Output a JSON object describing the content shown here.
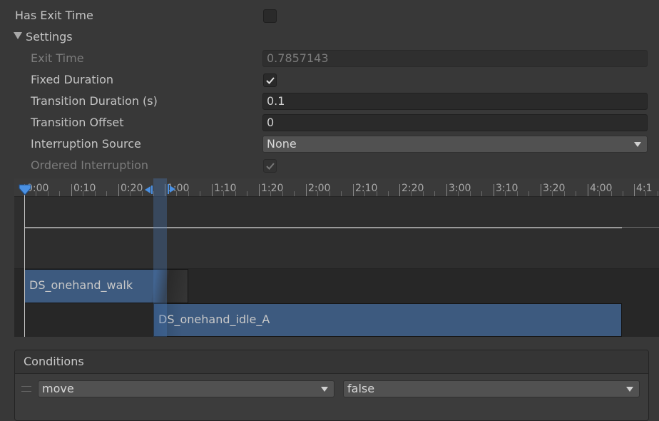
{
  "inspector": {
    "has_exit_time_label": "Has Exit Time",
    "has_exit_time_checked": false,
    "settings_label": "Settings",
    "exit_time": {
      "label": "Exit Time",
      "value": "0.7857143"
    },
    "fixed_duration": {
      "label": "Fixed Duration",
      "checked": true
    },
    "transition_duration": {
      "label": "Transition Duration (s)",
      "value": "0.1"
    },
    "transition_offset": {
      "label": "Transition Offset",
      "value": "0"
    },
    "interruption_source": {
      "label": "Interruption Source",
      "value": "None"
    },
    "ordered_interruption": {
      "label": "Ordered Interruption",
      "checked": true
    }
  },
  "timeline": {
    "ticks": [
      "0:00",
      "0:10",
      "0:20",
      "1:00",
      "1:10",
      "1:20",
      "2:00",
      "2:10",
      "2:20",
      "3:00",
      "3:10",
      "3:20",
      "4:00",
      "4:1"
    ],
    "clips": {
      "source": "DS_onehand_walk",
      "destination": "DS_onehand_idle_A"
    }
  },
  "conditions": {
    "header": "Conditions",
    "rows": [
      {
        "parameter": "move",
        "value": "false"
      }
    ]
  },
  "colors": {
    "background": "#383838",
    "clip_blue": "#3d5a7f",
    "playhead_blue": "#4a90e2"
  }
}
